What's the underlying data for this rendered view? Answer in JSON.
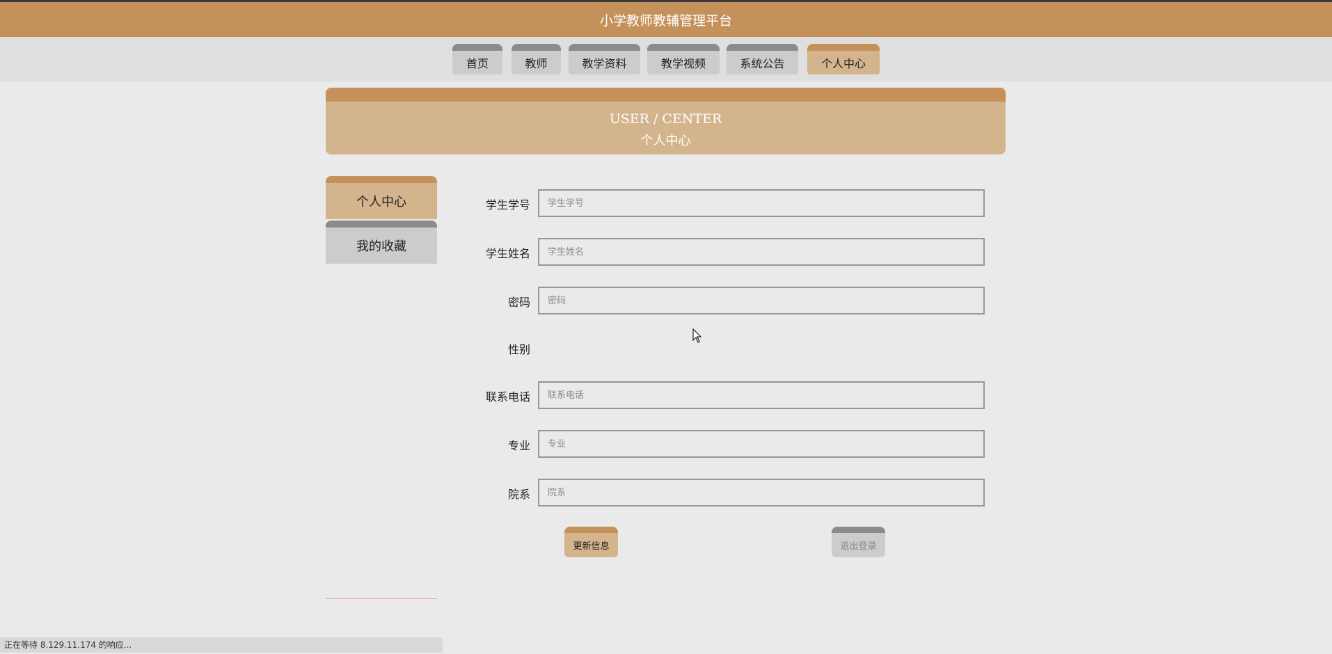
{
  "header": {
    "title": "小学教师教辅管理平台"
  },
  "nav": {
    "items": [
      {
        "label": "首页"
      },
      {
        "label": "教师"
      },
      {
        "label": "教学资料"
      },
      {
        "label": "教学视频"
      },
      {
        "label": "系统公告"
      },
      {
        "label": "个人中心"
      }
    ],
    "active": "个人中心"
  },
  "banner": {
    "en": "USER / CENTER",
    "zh": "个人中心"
  },
  "sidebar": {
    "items": [
      {
        "label": "个人中心"
      },
      {
        "label": "我的收藏"
      }
    ]
  },
  "form": {
    "fields": [
      {
        "label": "学生学号",
        "value": "",
        "placeholder": "学生学号"
      },
      {
        "label": "学生姓名",
        "value": "",
        "placeholder": "学生姓名"
      },
      {
        "label": "密码",
        "value": "",
        "placeholder": "密码"
      },
      {
        "label": "性别"
      },
      {
        "label": "联系电话",
        "value": "",
        "placeholder": "联系电话"
      },
      {
        "label": "专业",
        "value": "",
        "placeholder": "专业"
      },
      {
        "label": "院系",
        "value": "",
        "placeholder": "院系"
      }
    ],
    "update_label": "更新信息",
    "logout_label": "退出登录"
  },
  "status_bar": {
    "text": "正在等待 8.129.11.174 的响应..."
  },
  "colors": {
    "header": "#c5915a",
    "accent": "#d3b48c",
    "tab_gray": "#cdcccc",
    "tab_gray_top": "#8b8b8b"
  },
  "icons": {
    "cursor": "cursor-arrow-icon"
  }
}
